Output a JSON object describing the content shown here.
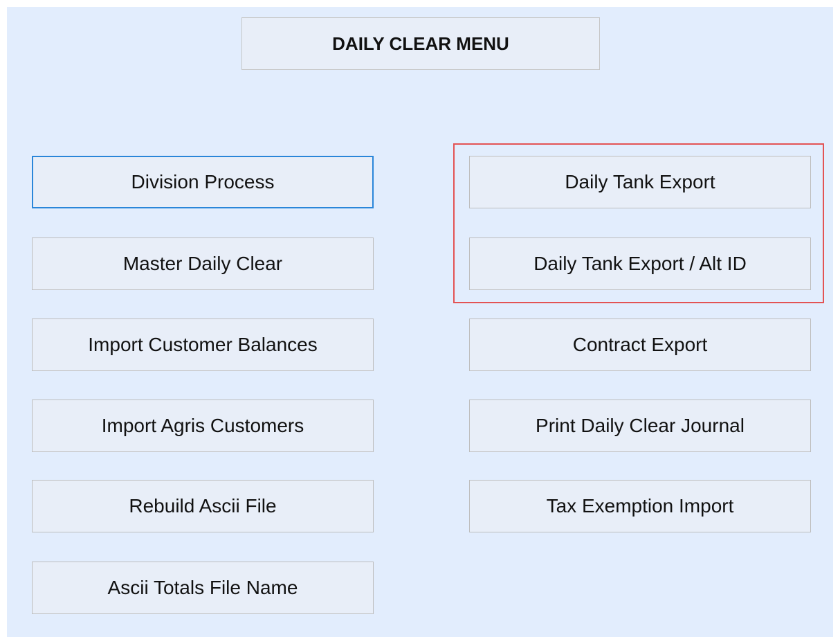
{
  "title": "DAILY CLEAR MENU",
  "left_buttons": [
    {
      "label": "Division Process"
    },
    {
      "label": "Master Daily Clear"
    },
    {
      "label": "Import Customer Balances"
    },
    {
      "label": "Import Agris Customers"
    },
    {
      "label": "Rebuild Ascii File"
    },
    {
      "label": "Ascii Totals File Name"
    }
  ],
  "right_buttons": [
    {
      "label": "Daily Tank Export"
    },
    {
      "label": "Daily Tank Export / Alt ID"
    },
    {
      "label": "Contract Export"
    },
    {
      "label": "Print Daily Clear Journal"
    },
    {
      "label": "Tax Exemption Import"
    }
  ],
  "colors": {
    "background": "#e2edfd",
    "button": "#e8eef8",
    "focus_border": "#2a86d9",
    "highlight_border": "#e35354"
  }
}
